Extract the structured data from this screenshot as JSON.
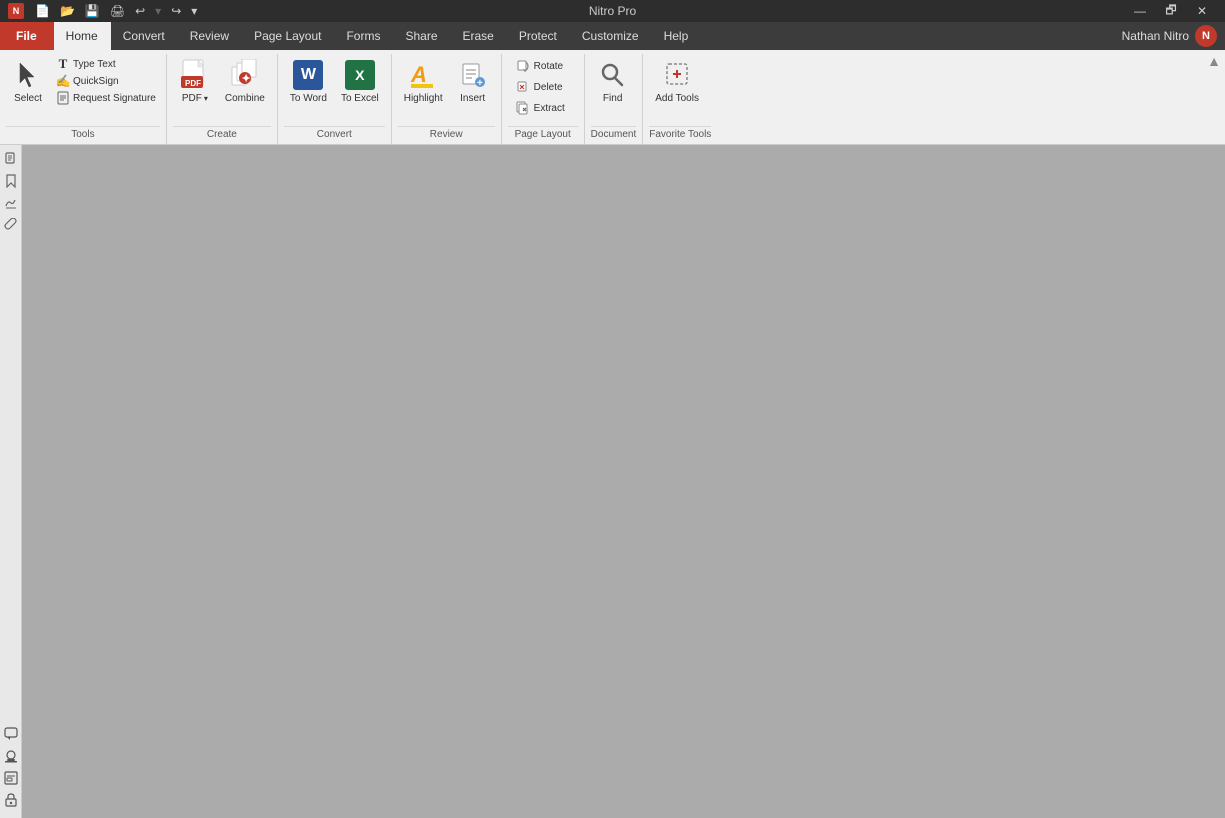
{
  "app": {
    "title": "Nitro Pro",
    "logo": "N"
  },
  "titlebar": {
    "quick_access": [
      "save-icon",
      "undo-icon",
      "redo-icon",
      "customize-icon"
    ],
    "undo_label": "↩",
    "redo_label": "↪",
    "save_label": "💾",
    "window_controls": {
      "minimize": "—",
      "maximize": "🗗",
      "close": "✕"
    }
  },
  "menubar": {
    "tabs": [
      {
        "id": "file",
        "label": "File",
        "active": false,
        "special": true
      },
      {
        "id": "home",
        "label": "Home",
        "active": true
      },
      {
        "id": "convert",
        "label": "Convert"
      },
      {
        "id": "review",
        "label": "Review"
      },
      {
        "id": "page-layout",
        "label": "Page Layout"
      },
      {
        "id": "forms",
        "label": "Forms"
      },
      {
        "id": "share",
        "label": "Share"
      },
      {
        "id": "erase",
        "label": "Erase"
      },
      {
        "id": "protect",
        "label": "Protect"
      },
      {
        "id": "customize",
        "label": "Customize"
      },
      {
        "id": "help",
        "label": "Help"
      }
    ],
    "user": {
      "name": "Nathan Nitro",
      "avatar_initial": "N"
    }
  },
  "ribbon": {
    "groups": [
      {
        "id": "tools",
        "label": "Tools",
        "items": [
          {
            "id": "select",
            "label": "Select",
            "type": "large",
            "icon": "cursor"
          },
          {
            "id": "text-tools",
            "type": "stacked",
            "items": [
              {
                "id": "type-text",
                "label": "Type Text",
                "icon": "T"
              },
              {
                "id": "quicksign",
                "label": "QuickSign",
                "icon": "✍"
              },
              {
                "id": "request-signature",
                "label": "Request Signature",
                "icon": "📝"
              }
            ]
          }
        ]
      },
      {
        "id": "create",
        "label": "Create",
        "items": [
          {
            "id": "pdf",
            "label": "PDF",
            "type": "large",
            "icon": "PDF",
            "has_dropdown": true
          },
          {
            "id": "combine",
            "label": "Combine",
            "type": "large",
            "icon": "combine",
            "has_dropdown": false
          }
        ]
      },
      {
        "id": "convert",
        "label": "Convert",
        "items": [
          {
            "id": "to-word",
            "label": "To Word",
            "type": "large",
            "icon": "W"
          },
          {
            "id": "to-excel",
            "label": "To Excel",
            "type": "large",
            "icon": "X"
          }
        ]
      },
      {
        "id": "review",
        "label": "Review",
        "items": [
          {
            "id": "highlight",
            "label": "Highlight",
            "type": "large",
            "icon": "A"
          },
          {
            "id": "insert",
            "label": "Insert",
            "type": "large",
            "icon": "insert"
          }
        ]
      },
      {
        "id": "page-layout",
        "label": "Page Layout",
        "items": [
          {
            "id": "page-actions",
            "type": "stacked",
            "items": [
              {
                "id": "rotate",
                "label": "Rotate",
                "icon": "↻"
              },
              {
                "id": "delete",
                "label": "Delete",
                "icon": "🗑"
              },
              {
                "id": "extract",
                "label": "Extract",
                "icon": "📄"
              }
            ]
          }
        ]
      },
      {
        "id": "document",
        "label": "Document",
        "items": [
          {
            "id": "find",
            "label": "Find",
            "type": "large",
            "icon": "🔍"
          }
        ]
      },
      {
        "id": "favorite-tools",
        "label": "Favorite Tools",
        "items": [
          {
            "id": "add-tools",
            "label": "Add Tools",
            "type": "large",
            "icon": "addtools"
          }
        ]
      }
    ]
  },
  "sidebar": {
    "top_icons": [
      "pages-icon",
      "bookmarks-icon",
      "signatures-icon",
      "attachments-icon"
    ],
    "bottom_icons": [
      "comments-icon",
      "stamps-icon",
      "forms-icon",
      "lock-icon"
    ]
  },
  "canvas": {
    "background": "#ababab"
  }
}
